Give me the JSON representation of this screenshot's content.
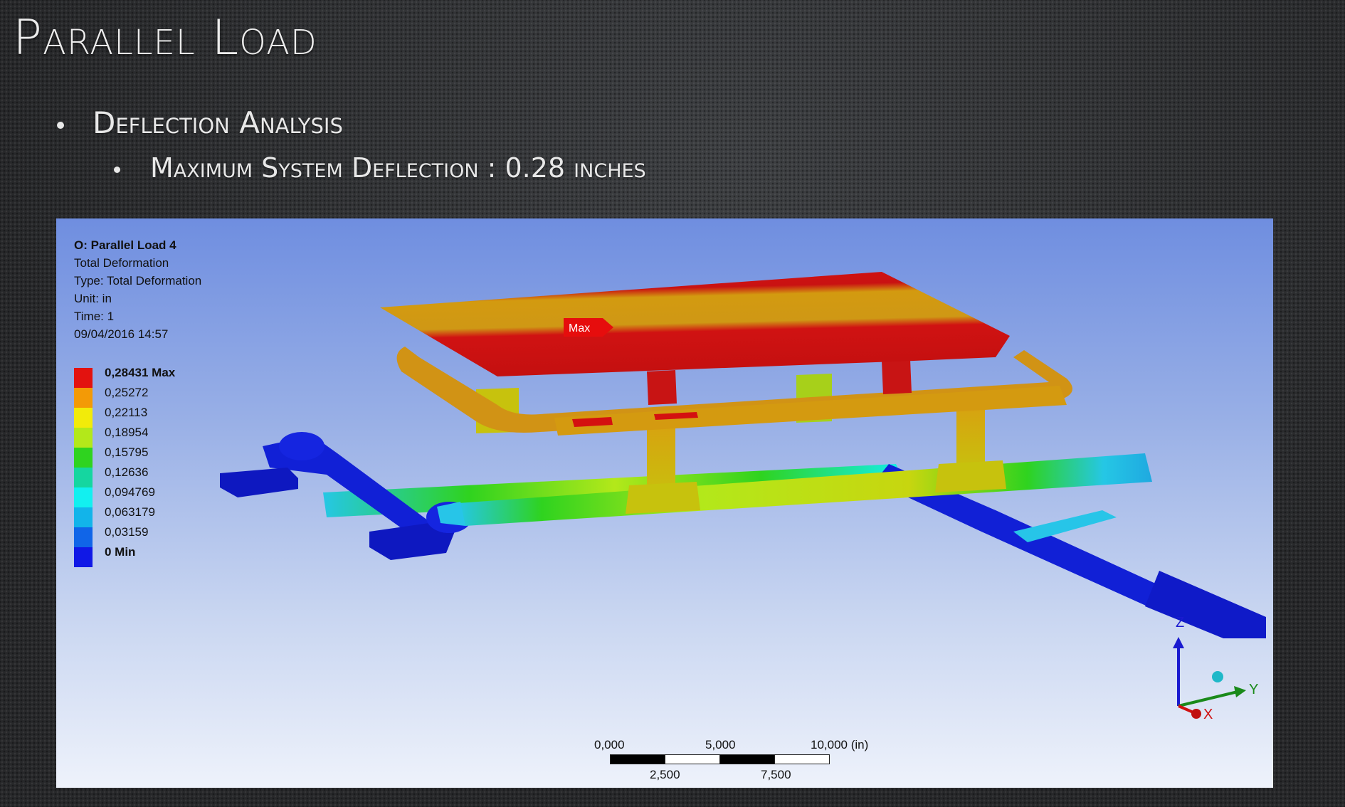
{
  "slide": {
    "title": "Parallel Load",
    "bullet1": "Deflection Analysis",
    "bullet2": "Maximum System Deflection : 0.28 inches"
  },
  "result": {
    "name": "O: Parallel Load 4",
    "label": "Total Deformation",
    "type": "Type: Total Deformation",
    "unit": "Unit: in",
    "time": "Time: 1",
    "date": "09/04/2016 14:57",
    "max_tag": "Max"
  },
  "legend": [
    {
      "label": "0,28431 Max",
      "color": "#e3120f",
      "bold": true
    },
    {
      "label": "0,25272",
      "color": "#f39a06",
      "bold": false
    },
    {
      "label": "0,22113",
      "color": "#f2eb0a",
      "bold": false
    },
    {
      "label": "0,18954",
      "color": "#b3e81a",
      "bold": false
    },
    {
      "label": "0,15795",
      "color": "#2fd31f",
      "bold": false
    },
    {
      "label": "0,12636",
      "color": "#15d6a0",
      "bold": false
    },
    {
      "label": "0,094769",
      "color": "#12f0f0",
      "bold": false
    },
    {
      "label": "0,063179",
      "color": "#12b4ea",
      "bold": false
    },
    {
      "label": "0,03159",
      "color": "#1065e8",
      "bold": false
    },
    {
      "label": "0 Min",
      "color": "#1018e6",
      "bold": true
    }
  ],
  "scale": {
    "l0": "0,000",
    "l1": "5,000",
    "l2": "10,000 (in)",
    "l3": "2,500",
    "l4": "7,500"
  },
  "triad": {
    "z": "Z",
    "y": "Y",
    "x": "X"
  }
}
